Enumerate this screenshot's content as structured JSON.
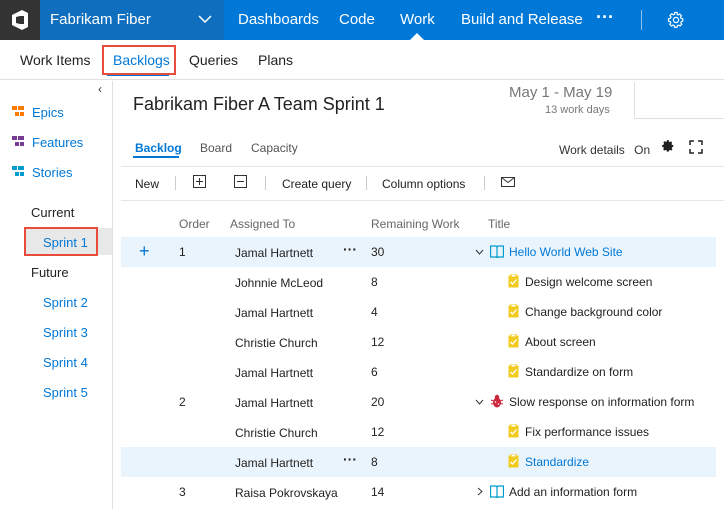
{
  "topbar": {
    "project_name": "Fabrikam Fiber",
    "nav": [
      "Dashboards",
      "Code",
      "Work",
      "Build and Release"
    ],
    "more": "···"
  },
  "subnav": [
    "Work Items",
    "Backlogs",
    "Queries",
    "Plans"
  ],
  "left_panel": {
    "backlog_levels": [
      "Epics",
      "Features",
      "Stories"
    ],
    "current_label": "Current",
    "current_sprint": "Sprint 1",
    "future_label": "Future",
    "future_sprints": [
      "Sprint 2",
      "Sprint 3",
      "Sprint 4",
      "Sprint 5"
    ],
    "colors": {
      "epics": "#ff7b00",
      "features": "#773b93",
      "stories": "#009ccc"
    }
  },
  "sprint": {
    "title": "Fabrikam Fiber A Team Sprint 1",
    "dates": "May 1 - May 19",
    "work_days": "13 work days"
  },
  "tabs": [
    "Backlog",
    "Board",
    "Capacity"
  ],
  "work_details": {
    "label": "Work details",
    "state": "On"
  },
  "toolbar": {
    "new": "New",
    "create_query": "Create query",
    "column_options": "Column options"
  },
  "columns": {
    "order": "Order",
    "assigned": "Assigned To",
    "remaining": "Remaining Work",
    "title": "Title"
  },
  "rows": [
    {
      "order": "1",
      "assigned": "Jamal Hartnett",
      "remaining": "30",
      "title": "Hello World Web Site",
      "type": "story"
    },
    {
      "order": "",
      "assigned": "Johnnie McLeod",
      "remaining": "8",
      "title": "Design welcome screen",
      "type": "task"
    },
    {
      "order": "",
      "assigned": "Jamal Hartnett",
      "remaining": "4",
      "title": "Change background color",
      "type": "task"
    },
    {
      "order": "",
      "assigned": "Christie Church",
      "remaining": "12",
      "title": "About screen",
      "type": "task"
    },
    {
      "order": "",
      "assigned": "Jamal Hartnett",
      "remaining": "6",
      "title": "Standardize on form",
      "type": "task"
    },
    {
      "order": "2",
      "assigned": "Jamal Hartnett",
      "remaining": "20",
      "title": "Slow response on information form",
      "type": "bug"
    },
    {
      "order": "",
      "assigned": "Christie Church",
      "remaining": "12",
      "title": "Fix performance issues",
      "type": "task"
    },
    {
      "order": "",
      "assigned": "Jamal Hartnett",
      "remaining": "8",
      "title": "Standardize",
      "type": "task"
    },
    {
      "order": "3",
      "assigned": "Raisa Pokrovskaya",
      "remaining": "14",
      "title": "Add an information form",
      "type": "story"
    }
  ],
  "icon_colors": {
    "story": "#009ccc",
    "task": "#f2cb1d",
    "bug": "#cc293d"
  }
}
